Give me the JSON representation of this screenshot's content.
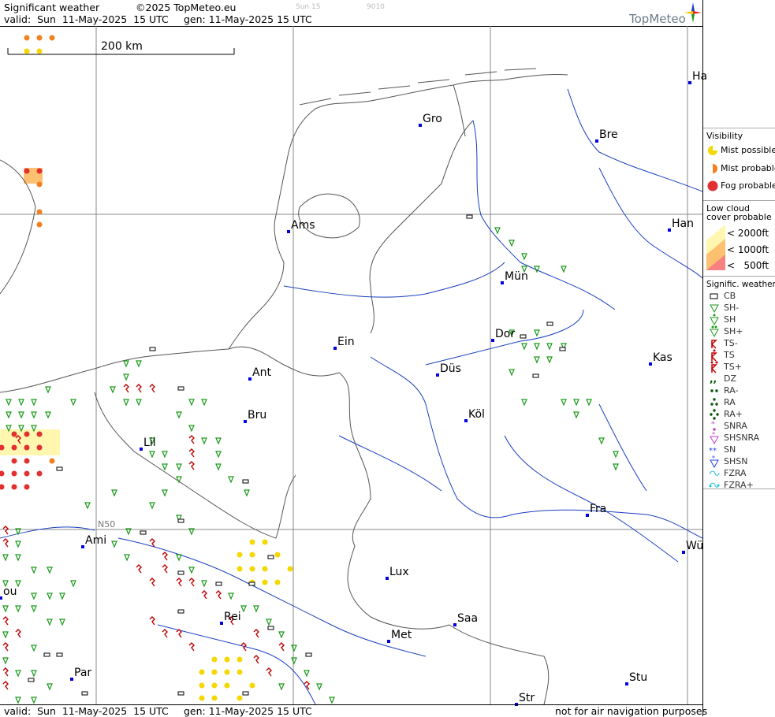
{
  "header": {
    "title": "Significant weather",
    "copyright": "©2025 TopMeteo.eu",
    "valid": "valid:  Sun  11-May-2025  15 UTC",
    "generated": "gen: 11-May-2025 15 UTC",
    "faint_day": "Sun 15",
    "faint_code": "9010",
    "logo_text": "TopMeteo"
  },
  "footer": {
    "valid": "valid:  Sun  11-May-2025  15 UTC",
    "generated": "gen: 11-May-2025 15 UTC",
    "disclaimer": "not for air navigation purposes"
  },
  "map": {
    "scale_label": "200 km",
    "grid_label": "N50",
    "colors": {
      "river": "#1a3fbf",
      "coast": "#555555",
      "border": "#555555",
      "grid": "#888888",
      "city": "#0000e0"
    },
    "cities": [
      {
        "name": "Ha",
        "icon": "city-marker"
      },
      {
        "name": "Gro",
        "icon": "city-marker"
      },
      {
        "name": "Bre",
        "icon": "city-marker"
      },
      {
        "name": "Ams",
        "icon": "city-marker"
      },
      {
        "name": "Han",
        "icon": "city-marker"
      },
      {
        "name": "Mün",
        "icon": "city-marker"
      },
      {
        "name": "Dor",
        "icon": "city-marker"
      },
      {
        "name": "Ein",
        "icon": "city-marker"
      },
      {
        "name": "Kas",
        "icon": "city-marker"
      },
      {
        "name": "Ant",
        "icon": "city-marker"
      },
      {
        "name": "Düs",
        "icon": "city-marker"
      },
      {
        "name": "Bru",
        "icon": "city-marker"
      },
      {
        "name": "Köl",
        "icon": "city-marker"
      },
      {
        "name": "Lil",
        "icon": "city-marker"
      },
      {
        "name": "Fra",
        "icon": "city-marker"
      },
      {
        "name": "Ami",
        "icon": "city-marker"
      },
      {
        "name": "Wü",
        "icon": "city-marker"
      },
      {
        "name": "Lux",
        "icon": "city-marker"
      },
      {
        "name": "ou",
        "icon": "city-marker"
      },
      {
        "name": "Rei",
        "icon": "city-marker"
      },
      {
        "name": "Saa",
        "icon": "city-marker"
      },
      {
        "name": "Met",
        "icon": "city-marker"
      },
      {
        "name": "Par",
        "icon": "city-marker"
      },
      {
        "name": "Stu",
        "icon": "city-marker"
      },
      {
        "name": "Str",
        "icon": "city-marker"
      }
    ]
  },
  "legend": {
    "visibility": {
      "title": "Visibility",
      "items": [
        {
          "label": "Mist possible",
          "icon": "mist-possible-icon",
          "color": "#f5d800"
        },
        {
          "label": "Mist probable",
          "icon": "mist-probable-icon",
          "color": "#f08020"
        },
        {
          "label": "Fog probable",
          "icon": "fog-probable-icon",
          "color": "#e03030"
        }
      ]
    },
    "low_cloud": {
      "title": "Low cloud cover probable",
      "items": [
        {
          "label": "< 2000ft",
          "color": "#fff7b0"
        },
        {
          "label": "< 1000ft",
          "color": "#fcc070"
        },
        {
          "label": "<   500ft",
          "color": "#f88080"
        }
      ]
    },
    "signific": {
      "title": "Signific. weather",
      "items": [
        {
          "label": "CB",
          "icon": "cb-icon",
          "color": "#000000"
        },
        {
          "label": "SH-",
          "icon": "shower-light-icon",
          "color": "#1a9a1a"
        },
        {
          "label": "SH",
          "icon": "shower-icon",
          "color": "#1a9a1a"
        },
        {
          "label": "SH+",
          "icon": "shower-heavy-icon",
          "color": "#1a9a1a"
        },
        {
          "label": "TS-",
          "icon": "thunderstorm-light-icon",
          "color": "#c00000"
        },
        {
          "label": "TS",
          "icon": "thunderstorm-icon",
          "color": "#c00000"
        },
        {
          "label": "TS+",
          "icon": "thunderstorm-heavy-icon",
          "color": "#c00000"
        },
        {
          "label": "DZ",
          "icon": "drizzle-icon",
          "color": "#005500"
        },
        {
          "label": "RA-",
          "icon": "rain-light-icon",
          "color": "#005500"
        },
        {
          "label": "RA",
          "icon": "rain-icon",
          "color": "#005500"
        },
        {
          "label": "RA+",
          "icon": "rain-heavy-icon",
          "color": "#005500"
        },
        {
          "label": "SNRA",
          "icon": "snow-rain-icon",
          "color": "#c040c0"
        },
        {
          "label": "SHSNRA",
          "icon": "snow-rain-shower-icon",
          "color": "#c040c0"
        },
        {
          "label": "SN",
          "icon": "snow-icon",
          "color": "#2040e0"
        },
        {
          "label": "SHSN",
          "icon": "snow-shower-icon",
          "color": "#2040e0"
        },
        {
          "label": "FZRA",
          "icon": "freezing-rain-icon",
          "color": "#20c0e0"
        },
        {
          "label": "FZRA+",
          "icon": "freezing-rain-heavy-icon",
          "color": "#20c0e0"
        }
      ]
    }
  }
}
